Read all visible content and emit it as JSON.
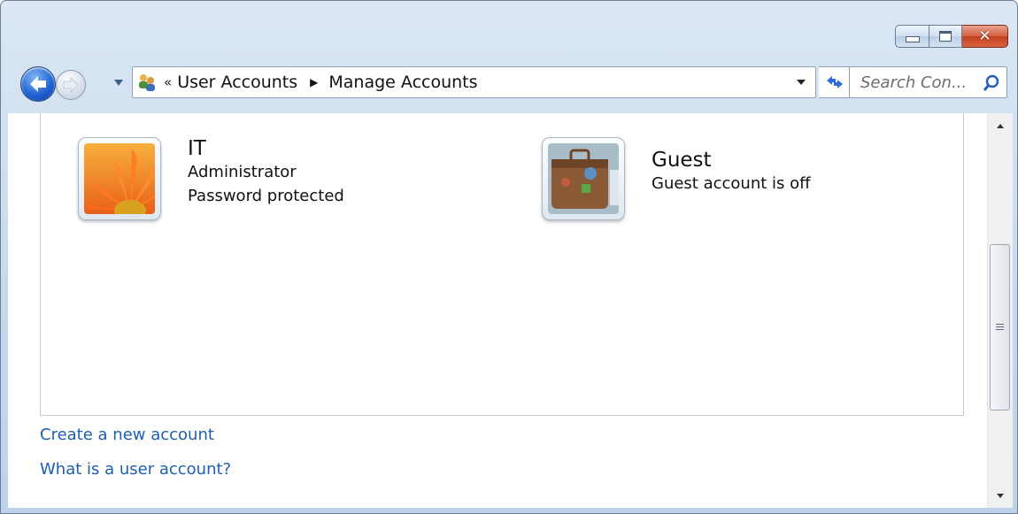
{
  "window": {
    "controls": {
      "minimize": "minimize",
      "maximize": "maximize",
      "close": "close"
    }
  },
  "navbar": {
    "address": {
      "overflow_chevron": "«",
      "breadcrumbs": [
        "User Accounts",
        "Manage Accounts"
      ]
    },
    "search": {
      "placeholder": "Search Con..."
    }
  },
  "accounts": [
    {
      "name": "IT",
      "lines": [
        "Administrator",
        "Password protected"
      ],
      "picture": "flower"
    },
    {
      "name": "Guest",
      "lines": [
        "Guest account is off"
      ],
      "picture": "suitcase"
    }
  ],
  "links": {
    "create": "Create a new account",
    "what_is": "What is a user account?"
  },
  "colors": {
    "link": "#1c5fb0",
    "frame": "#c5d8ec",
    "close_button": "#c4401f"
  }
}
